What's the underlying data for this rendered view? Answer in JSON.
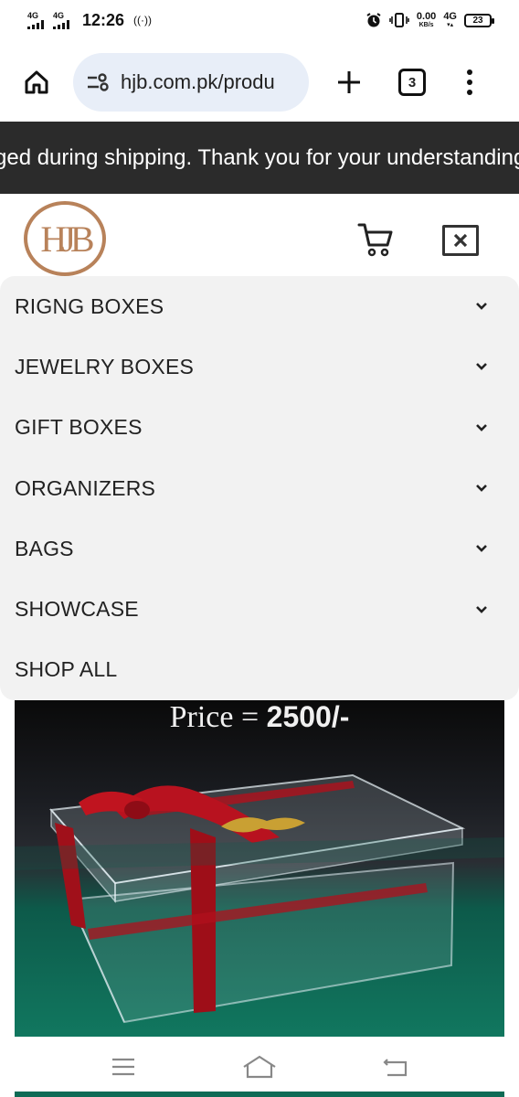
{
  "status_bar": {
    "network1": "4G",
    "network2": "4G",
    "time": "12:26",
    "speed_value": "0.00",
    "speed_unit": "KB/s",
    "network3": "4G",
    "battery": "23"
  },
  "browser": {
    "url": "hjb.com.pk/produ",
    "tab_count": "3"
  },
  "announcement": "ged during shipping. Thank you for your understanding",
  "header": {
    "logo_text": "HJB"
  },
  "menu": {
    "items": [
      {
        "label": "RIGNG BOXES",
        "has_chevron": true
      },
      {
        "label": "JEWELRY BOXES",
        "has_chevron": true
      },
      {
        "label": "GIFT BOXES",
        "has_chevron": true
      },
      {
        "label": "ORGANIZERS",
        "has_chevron": true
      },
      {
        "label": "BAGS",
        "has_chevron": true
      },
      {
        "label": "SHOWCASE",
        "has_chevron": true
      },
      {
        "label": "SHOP ALL",
        "has_chevron": false
      }
    ]
  },
  "product": {
    "price_label": "Price = ",
    "price_value": "2500/-",
    "ribbon_color": "#b0101c"
  },
  "colors": {
    "announcement_bg": "#2b2b2b",
    "url_pill_bg": "#e8eef8",
    "menu_bg": "#f2f2f2",
    "logo_color": "#b8825a"
  }
}
